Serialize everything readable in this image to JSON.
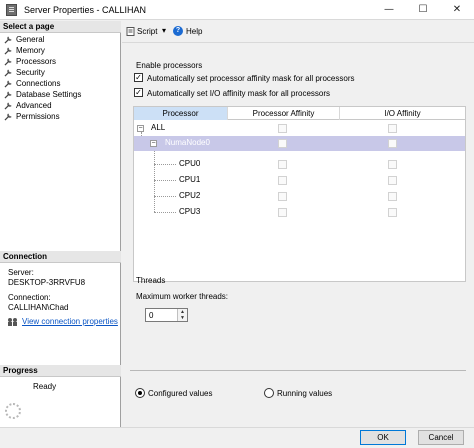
{
  "window": {
    "title": "Server Properties - CALLIHAN",
    "minimize": "—",
    "maximize": "☐",
    "close": "✕"
  },
  "left": {
    "select_page_header": "Select a page",
    "pages": [
      "General",
      "Memory",
      "Processors",
      "Security",
      "Connections",
      "Database Settings",
      "Advanced",
      "Permissions"
    ],
    "connection_header": "Connection",
    "server_label": "Server:",
    "server_value": "DESKTOP-3RRVFU8",
    "connection_label": "Connection:",
    "connection_value": "CALLIHAN\\Chad",
    "view_props_link": "View connection properties",
    "progress_header": "Progress",
    "progress_status": "Ready"
  },
  "toolbar": {
    "script_label": "Script",
    "script_dropdown": "▾",
    "help_icon": "?",
    "help_label": "Help"
  },
  "processors": {
    "enable_label": "Enable processors",
    "auto_affinity_label": "Automatically set processor affinity mask for all processors",
    "auto_io_label": "Automatically set I/O affinity mask for all processors",
    "check_mark": "✓",
    "columns": [
      "Processor",
      "Processor Affinity",
      "I/O Affinity"
    ],
    "rows": [
      {
        "name": "ALL",
        "expander": "−"
      },
      {
        "name": "NumaNode0",
        "expander": "−"
      },
      {
        "name": "CPU0"
      },
      {
        "name": "CPU1"
      },
      {
        "name": "CPU2"
      },
      {
        "name": "CPU3"
      }
    ]
  },
  "threads": {
    "header": "Threads",
    "max_label": "Maximum worker threads:",
    "max_value": "0",
    "spin_up": "▲",
    "spin_down": "▼"
  },
  "view_mode": {
    "configured_label": "Configured values",
    "running_label": "Running values"
  },
  "buttons": {
    "ok": "OK",
    "cancel": "Cancel"
  }
}
